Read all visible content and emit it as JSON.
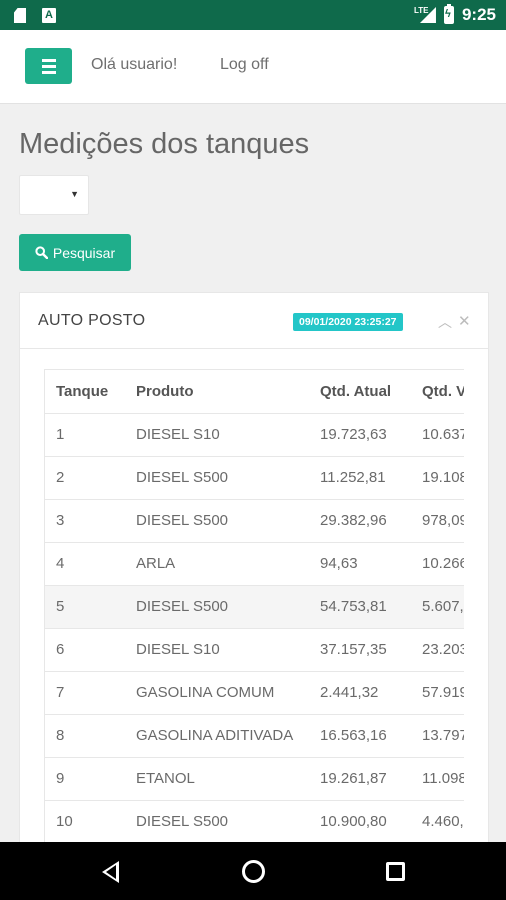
{
  "statusbar": {
    "network": "LTE",
    "time": "9:25",
    "notification_icon": "A"
  },
  "header": {
    "greeting": "Olá usuario!",
    "logoff": "Log off"
  },
  "page": {
    "title": "Medições dos tanques",
    "select_value": "",
    "search_label": "Pesquisar"
  },
  "panel": {
    "title": "AUTO POSTO",
    "timestamp": "09/01/2020 23:25:27"
  },
  "table": {
    "columns": [
      "Tanque",
      "Produto",
      "Qtd. Atual",
      "Qtd. V"
    ],
    "rows": [
      [
        "1",
        "DIESEL S10",
        "19.723,63",
        "10.637"
      ],
      [
        "2",
        "DIESEL S500",
        "11.252,81",
        "19.108"
      ],
      [
        "3",
        "DIESEL S500",
        "29.382,96",
        "978,09"
      ],
      [
        "4",
        "ARLA",
        "94,63",
        "10.266"
      ],
      [
        "5",
        "DIESEL S500",
        "54.753,81",
        "5.607,"
      ],
      [
        "6",
        "DIESEL S10",
        "37.157,35",
        "23.203"
      ],
      [
        "7",
        "GASOLINA COMUM",
        "2.441,32",
        "57.919"
      ],
      [
        "8",
        "GASOLINA ADITIVADA",
        "16.563,16",
        "13.797"
      ],
      [
        "9",
        "ETANOL",
        "19.261,87",
        "11.098"
      ],
      [
        "10",
        "DIESEL S500",
        "10.900,80",
        "4.460,"
      ]
    ]
  },
  "colors": {
    "primary": "#1fae8b",
    "statusbar": "#0f6a4b",
    "badge": "#23c6c8"
  }
}
